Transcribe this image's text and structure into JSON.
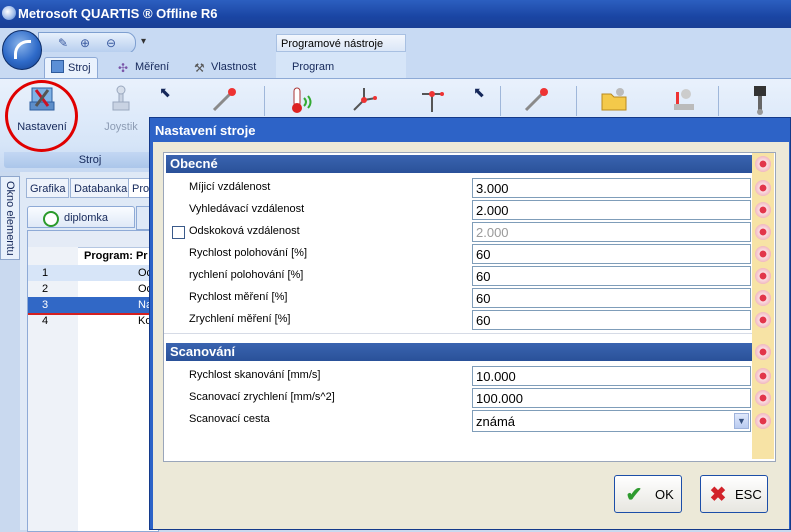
{
  "window": {
    "title": "Metrosoft QUARTIS ® Offline R6"
  },
  "ribbon": {
    "contextual_group": "Programové nástroje",
    "tabs": [
      {
        "label": "Stroj"
      },
      {
        "label": "Měření"
      },
      {
        "label": "Vlastnost"
      },
      {
        "label": "Program"
      }
    ],
    "buttons": {
      "nastaveni": "Nastavení",
      "joystik": "Joystik"
    },
    "group_label": "Stroj"
  },
  "side_panel": {
    "tab": "Okno elementu"
  },
  "document": {
    "tabs": [
      "Grafika",
      "Databanka",
      "Pro"
    ],
    "file_tab": "diplomka",
    "tree_header": "Program: Pr",
    "rows": [
      {
        "num": "1",
        "text": "Oc"
      },
      {
        "num": "2",
        "text": "Oc"
      },
      {
        "num": "3",
        "text": "Na"
      },
      {
        "num": "4",
        "text": "Ko"
      }
    ]
  },
  "dialog": {
    "title": "Nastavení stroje",
    "section_general": "Obecné",
    "general_rows": [
      {
        "label": "Míjicí vzdálenost",
        "value": "3.000"
      },
      {
        "label": "Vyhledávací vzdálenost",
        "value": "2.000"
      },
      {
        "label": "Odskoková vzdálenost",
        "value": "2.000"
      },
      {
        "label": "Rychlost polohování [%]",
        "value": "60"
      },
      {
        "label": "rychlení polohování [%]",
        "value": "60"
      },
      {
        "label": "Rychlost měření [%]",
        "value": "60"
      },
      {
        "label": "Zrychlení měření [%]",
        "value": "60"
      }
    ],
    "section_scan": "Scanování",
    "scan_rows": [
      {
        "label": "Rychlost skanování [mm/s]",
        "value": "10.000"
      },
      {
        "label": "Scanovací zrychlení [mm/s^2]",
        "value": "100.000"
      },
      {
        "label": "Scanovací cesta",
        "value": "známá"
      }
    ],
    "ok": "OK",
    "esc": "ESC"
  },
  "colors": {
    "accent": "#2d63c7",
    "section_header": "#2a5199",
    "pin_column": "#f7e3a5",
    "highlight_circle": "#e00000"
  }
}
